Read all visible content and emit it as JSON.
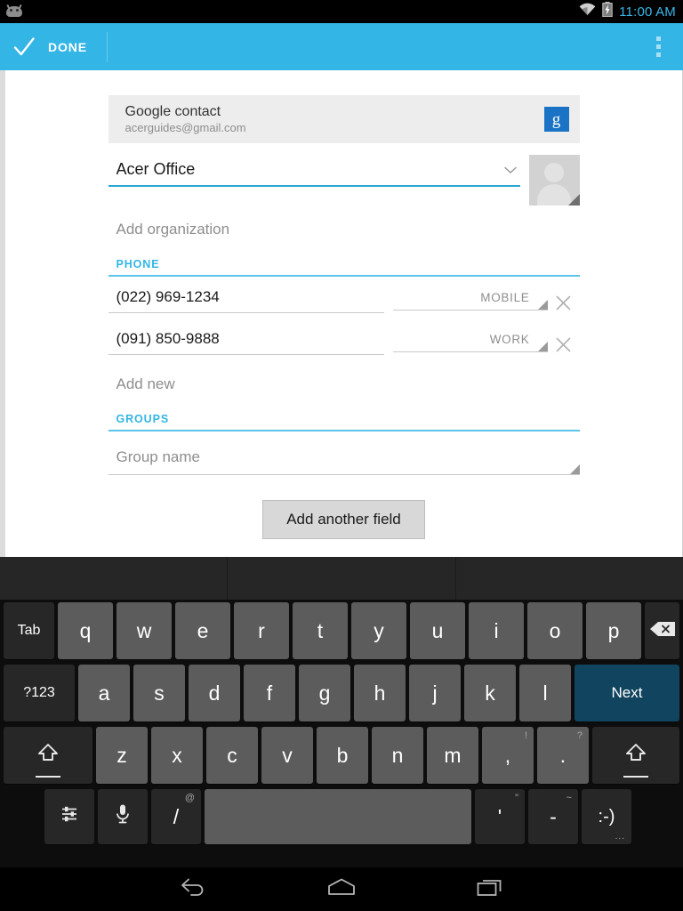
{
  "status_bar": {
    "app_icon": "android-robot-icon",
    "wifi_icon": "wifi-icon",
    "battery_icon": "battery-charging-icon",
    "clock": "11:00 AM",
    "clock_color": "#39b8e8"
  },
  "action_bar": {
    "done_label": "DONE",
    "check_icon": "check-icon",
    "overflow_icon": "overflow-menu-icon",
    "background_color": "#33b5e5"
  },
  "account": {
    "type_label": "Google contact",
    "email": "acerguides@gmail.com",
    "badge_letter": "g",
    "badge_color": "#1a73c4"
  },
  "name_field": {
    "value": "Acer Office",
    "expand_icon": "chevron-down-icon",
    "underline_color": "#2ba6d4"
  },
  "photo": {
    "icon": "contact-photo-placeholder-icon"
  },
  "organization": {
    "placeholder": "Add organization"
  },
  "phone": {
    "section_label": "PHONE",
    "entries": [
      {
        "number": "(022) 969-1234",
        "type": "MOBILE",
        "delete_icon": "close-icon"
      },
      {
        "number": "(091) 850-9888",
        "type": "WORK",
        "delete_icon": "close-icon"
      }
    ],
    "add_new_label": "Add new"
  },
  "groups": {
    "section_label": "GROUPS",
    "placeholder": "Group name"
  },
  "add_field": {
    "label": "Add another field"
  },
  "keyboard": {
    "row1": [
      {
        "label": "Tab",
        "style": "func"
      },
      {
        "label": "q",
        "style": "normal"
      },
      {
        "label": "w",
        "style": "normal"
      },
      {
        "label": "e",
        "style": "normal"
      },
      {
        "label": "r",
        "style": "normal"
      },
      {
        "label": "t",
        "style": "normal"
      },
      {
        "label": "y",
        "style": "normal"
      },
      {
        "label": "u",
        "style": "normal"
      },
      {
        "label": "i",
        "style": "normal"
      },
      {
        "label": "o",
        "style": "normal"
      },
      {
        "label": "p",
        "style": "normal"
      },
      {
        "label": "",
        "style": "backspace",
        "icon": "backspace-icon"
      }
    ],
    "row2": [
      {
        "label": "?123",
        "style": "func"
      },
      {
        "label": "a",
        "style": "normal"
      },
      {
        "label": "s",
        "style": "normal"
      },
      {
        "label": "d",
        "style": "normal"
      },
      {
        "label": "f",
        "style": "normal"
      },
      {
        "label": "g",
        "style": "normal"
      },
      {
        "label": "h",
        "style": "normal"
      },
      {
        "label": "j",
        "style": "normal"
      },
      {
        "label": "k",
        "style": "normal"
      },
      {
        "label": "l",
        "style": "normal"
      },
      {
        "label": "Next",
        "style": "accent"
      }
    ],
    "row3": [
      {
        "label": "",
        "style": "shift",
        "icon": "shift-icon"
      },
      {
        "label": "z",
        "style": "normal"
      },
      {
        "label": "x",
        "style": "normal"
      },
      {
        "label": "c",
        "style": "normal"
      },
      {
        "label": "v",
        "style": "normal"
      },
      {
        "label": "b",
        "style": "normal"
      },
      {
        "label": "n",
        "style": "normal"
      },
      {
        "label": "m",
        "style": "normal"
      },
      {
        "label": ",",
        "style": "normal",
        "sup": "!"
      },
      {
        "label": ".",
        "style": "normal",
        "sup": "?"
      },
      {
        "label": "",
        "style": "shift",
        "icon": "shift-icon"
      }
    ],
    "row4": [
      {
        "label": "",
        "style": "func",
        "icon": "keyboard-settings-icon"
      },
      {
        "label": "",
        "style": "func",
        "icon": "microphone-icon"
      },
      {
        "label": "/",
        "style": "func",
        "sup": "@"
      },
      {
        "label": "",
        "style": "space"
      },
      {
        "label": "'",
        "style": "func",
        "sup": "\""
      },
      {
        "label": "-",
        "style": "func",
        "sup": "~"
      },
      {
        "label": ":-)",
        "style": "func",
        "dots": "..."
      }
    ]
  },
  "nav_bar": {
    "back_icon": "back-icon",
    "home_icon": "home-icon",
    "recents_icon": "recent-apps-icon"
  }
}
